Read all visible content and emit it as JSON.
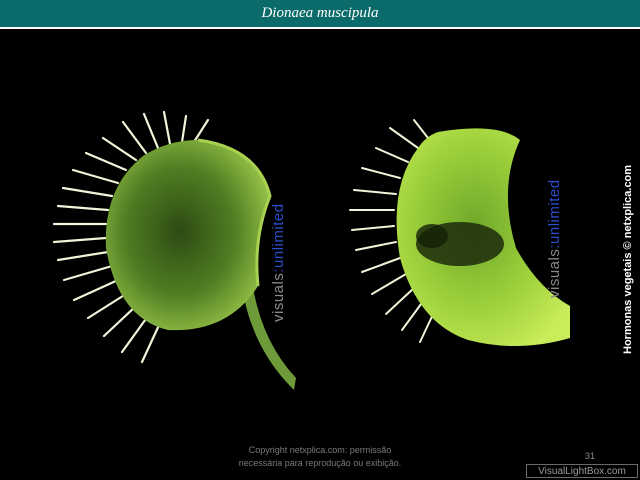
{
  "header": {
    "title": "Dionaea muscipula"
  },
  "photos": [
    {
      "watermark_part1": "visuals",
      "watermark_colon": ":",
      "watermark_part2": "unlimited"
    },
    {
      "watermark_part1": "visuals",
      "watermark_colon": ":",
      "watermark_part2": "unlimited"
    }
  ],
  "side_credit": "Hormonas vegetais © netxplica.com",
  "footer": {
    "copyright_line1": "Copyright netxplica.com: permissão",
    "copyright_line2": "necessária para reprodução ou exibição.",
    "page_number": "31",
    "logo": "VisualLightBox.com"
  },
  "colors": {
    "title_bar": "#0b6b6a",
    "watermark_accent": "#2b4cc8",
    "leaf_dark": "#3f6a1f",
    "leaf_bright": "#b8e34a"
  }
}
